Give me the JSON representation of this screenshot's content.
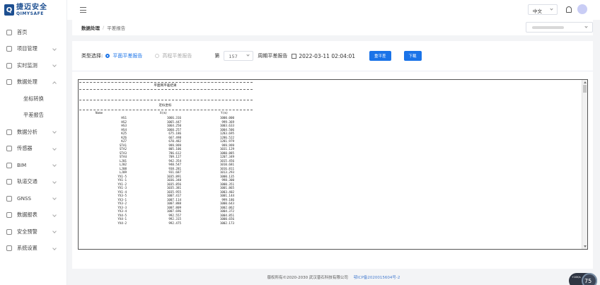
{
  "brand": {
    "mark": "Q",
    "cn": "捷迈安全",
    "en": "QIMYSAFE"
  },
  "sidebar": {
    "items": [
      {
        "label": "首页",
        "has_chevron": false
      },
      {
        "label": "项目管理",
        "has_chevron": true
      },
      {
        "label": "实时监测",
        "has_chevron": true
      },
      {
        "label": "数据处理",
        "has_chevron": true,
        "open": true
      },
      {
        "label": "坐标转换",
        "sub": true
      },
      {
        "label": "平差报告",
        "sub": true
      },
      {
        "label": "数据分析",
        "has_chevron": true
      },
      {
        "label": "传感器",
        "has_chevron": true
      },
      {
        "label": "BIM",
        "has_chevron": true
      },
      {
        "label": "轨道交通",
        "has_chevron": true
      },
      {
        "label": "GNSS",
        "has_chevron": true
      },
      {
        "label": "数据报表",
        "has_chevron": true
      },
      {
        "label": "安全预警",
        "has_chevron": true
      },
      {
        "label": "系统设置",
        "has_chevron": true
      }
    ]
  },
  "header": {
    "language": "中文"
  },
  "breadcrumb": {
    "parent": "数据处理",
    "separator": "/",
    "current": "平差报告"
  },
  "filters": {
    "type_label": "类型选择:",
    "option_plane": "平面平差报告",
    "option_elevation": "高程平差报告",
    "period_prefix": "第",
    "period_value": "157",
    "report_label": "周期平差报告",
    "datetime": "2022-03-11  02:04:01",
    "recompute_button": "重平差",
    "download_button": "下载"
  },
  "report": {
    "title": "平面网平差结果",
    "subtitle": "近似坐标",
    "columns": [
      "Name",
      "X(m)",
      "Y(m)"
    ],
    "rows": [
      [
        "HS1",
        "1066.316",
        "1000.000"
      ],
      [
        "HS2",
        "1065.447",
        "999.369"
      ],
      [
        "HS3",
        "1064.250",
        "1003.633"
      ],
      [
        "HS4",
        "1060.257",
        "1004.506"
      ],
      [
        "KZ5",
        "675.186",
        "1283.695"
      ],
      [
        "KZ6",
        "667.498",
        "1286.522"
      ],
      [
        "KZ7",
        "670.482",
        "1281.979"
      ],
      [
        "STA1",
        "999.999",
        "999.999"
      ],
      [
        "STA2",
        "805.106",
        "1031.129"
      ],
      [
        "STA3",
        "786.612",
        "1080.885"
      ],
      [
        "STA4",
        "709.127",
        "1207.349"
      ],
      [
        "LJ01",
        "942.354",
        "1015.456"
      ],
      [
        "LJ02",
        "940.547",
        "1010.681"
      ],
      [
        "LJ08",
        "938.281",
        "1016.811"
      ],
      [
        "LJ09",
        "931.687",
        "1013.293"
      ],
      [
        "YX1-5",
        "1035.891",
        "1000.135"
      ],
      [
        "YX1-1",
        "1036.348",
        "998.300"
      ],
      [
        "YX1-2",
        "1035.856",
        "1000.351"
      ],
      [
        "YX1-3",
        "1035.381",
        "1001.865"
      ],
      [
        "YX1-4",
        "1035.955",
        "1003.402"
      ],
      [
        "YX3-5",
        "1007.417",
        "1001.144"
      ],
      [
        "YX3-1",
        "1007.114",
        "999.186"
      ],
      [
        "YX3-2",
        "1007.888",
        "1000.643"
      ],
      [
        "YX3-3",
        "1007.809",
        "1002.062"
      ],
      [
        "YX3-4",
        "1007.696",
        "1004.372"
      ],
      [
        "YX4-5",
        "992.557",
        "1004.851"
      ],
      [
        "YX4-1",
        "992.315",
        "1000.656"
      ],
      [
        "YX4-2",
        "992.475",
        "1002.173"
      ]
    ]
  },
  "footer": {
    "copyright": "版权所有©2020-2030 武汉普石科技有限公司",
    "icp": "鄂ICP备2020015604号-2"
  },
  "speed_widget": {
    "small": "+10K/s",
    "value": "75"
  },
  "colors": {
    "accent": "#1a73e8",
    "brand": "#1d4f91"
  }
}
